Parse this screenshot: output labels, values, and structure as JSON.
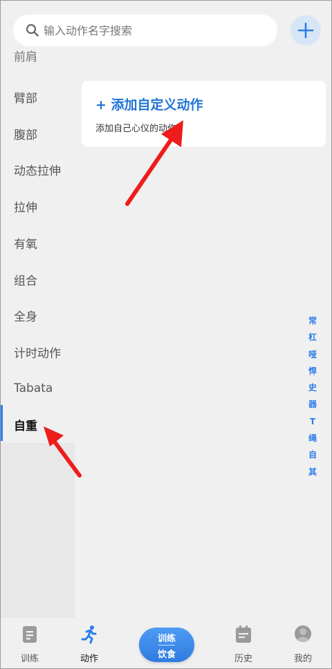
{
  "search": {
    "placeholder": "输入动作名字搜索",
    "icon": "search-icon"
  },
  "add_button": {
    "icon": "plus-icon",
    "color": "#2b7de9"
  },
  "sidebar": {
    "partial_item": "前肩",
    "items": [
      "臂部",
      "腹部",
      "动态拉伸",
      "拉伸",
      "有氧",
      "组合",
      "全身",
      "计时动作",
      "Tabata",
      "自重"
    ],
    "active_index": 9
  },
  "card": {
    "title": "+ 添加自定义动作",
    "subtitle": "添加自己心仪的动作"
  },
  "index": [
    "常",
    "杠",
    "哑",
    "悍",
    "史",
    "器",
    "T",
    "绳",
    "自",
    "其"
  ],
  "bottom_nav": {
    "items": [
      {
        "label": "训练",
        "icon": "clipboard-icon"
      },
      {
        "label": "动作",
        "icon": "running-icon"
      },
      {
        "label": "历史",
        "icon": "calendar-icon"
      },
      {
        "label": "我的",
        "icon": "user-icon"
      }
    ],
    "center_pill": {
      "top": "训练",
      "bottom": "饮食"
    }
  },
  "colors": {
    "accent": "#2b7de9",
    "annotation_arrow": "#ee1c1c",
    "background": "#f0f0f0"
  }
}
